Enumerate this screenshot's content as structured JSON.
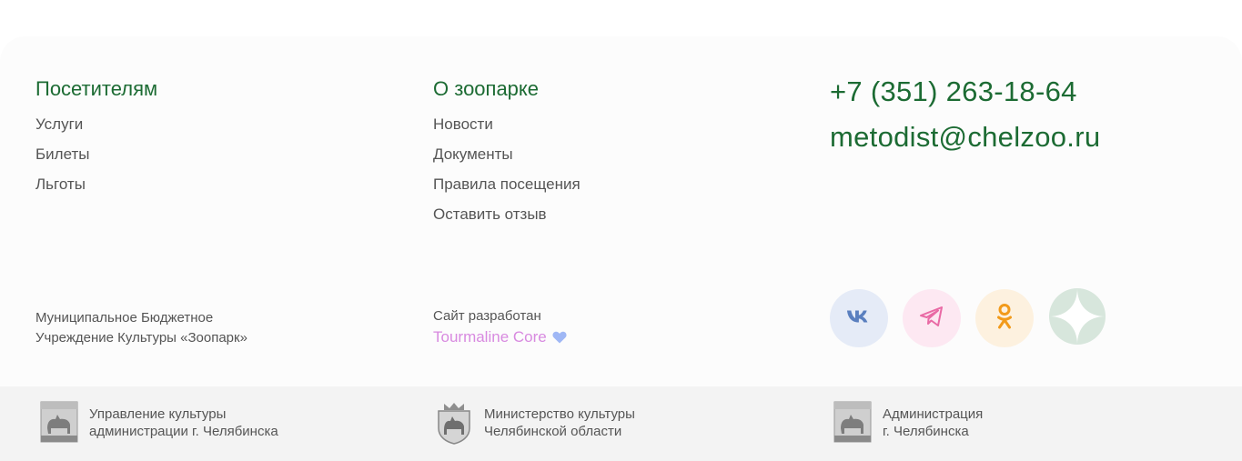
{
  "visitors": {
    "title": "Посетителям",
    "links": [
      "Услуги",
      "Билеты",
      "Льготы"
    ]
  },
  "about": {
    "title": "О зоопарке",
    "links": [
      "Новости",
      "Документы",
      "Правила посещения",
      "Оставить отзыв"
    ]
  },
  "contacts": {
    "phone": "+7 (351) 263-18-64",
    "email": "metodist@chelzoo.ru"
  },
  "organization": {
    "line1": "Муниципальное Бюджетное",
    "line2": "Учреждение Культуры «Зоопарк»"
  },
  "developer": {
    "label": "Сайт разработан",
    "name": "Tourmaline Core"
  },
  "socials": [
    {
      "icon": "vk-icon",
      "color": "#5a7fbf"
    },
    {
      "icon": "telegram-icon",
      "color": "#e96aa5"
    },
    {
      "icon": "odnoklassniki-icon",
      "color": "#f29a1a"
    },
    {
      "icon": "zen-icon",
      "color": "#d7e6dc"
    }
  ],
  "government": [
    {
      "line1": "Управление культуры",
      "line2": "администрации г. Челябинска",
      "icon": "chelyabinsk-coat-of-arms-icon"
    },
    {
      "line1": "Министерство культуры",
      "line2": "Челябинской области",
      "icon": "chelyabinsk-region-coat-of-arms-icon"
    },
    {
      "line1": "Администрация",
      "line2": "г. Челябинска",
      "icon": "chelyabinsk-coat-of-arms-icon"
    }
  ],
  "colors": {
    "brand_green": "#1c6b33",
    "text_gray": "#555555",
    "developer_pink": "#d88ae0",
    "heart_blue": "#9fb7f5"
  }
}
